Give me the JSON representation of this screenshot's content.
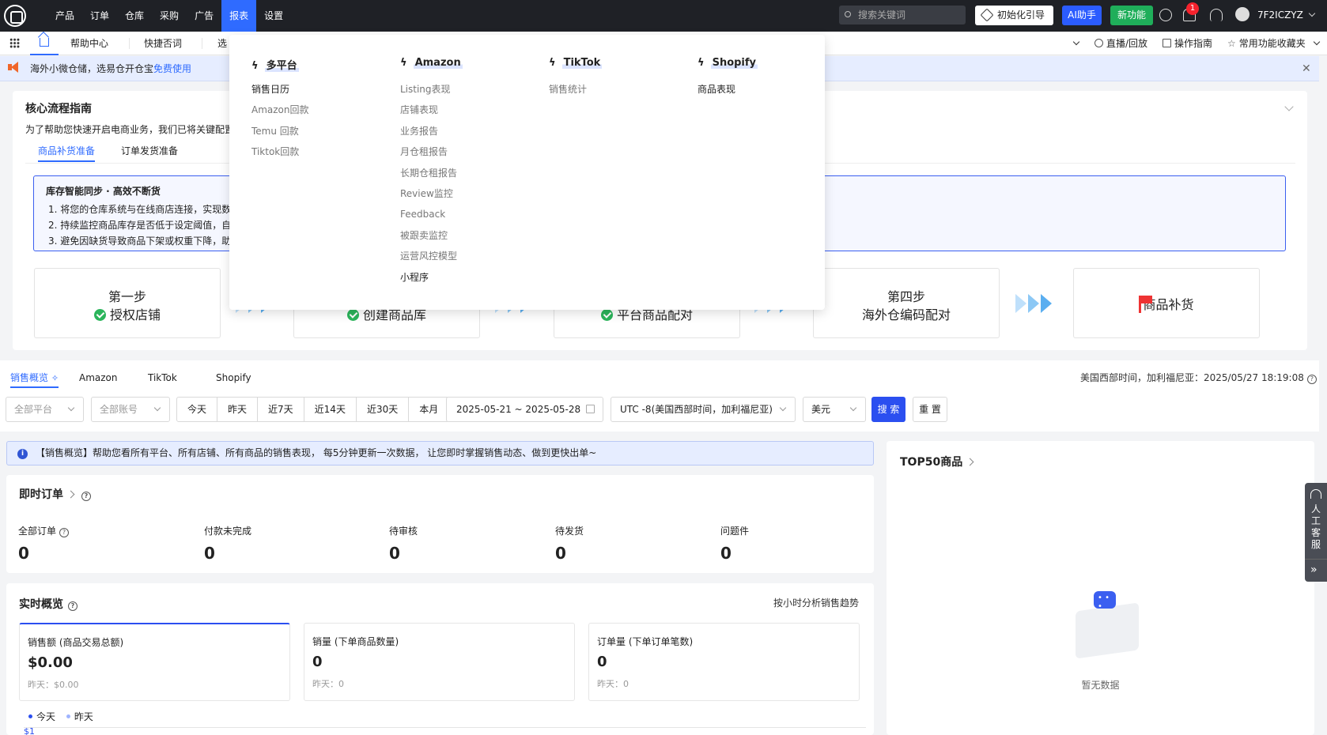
{
  "topbar": {
    "nav": [
      "产品",
      "订单",
      "仓库",
      "采购",
      "广告",
      "报表",
      "设置"
    ],
    "active_nav": "报表",
    "search_placeholder": "搜索关键词",
    "init_guide": "初始化引导",
    "ai_assistant": "AI助手",
    "new_feature": "新功能",
    "notification_count": "1",
    "username": "7F2ICZYZ"
  },
  "tabbar": {
    "tabs": [
      "帮助中心",
      "快捷否词",
      "选"
    ],
    "tools": {
      "live": "直播/回放",
      "guide": "操作指南",
      "favorites": "常用功能收藏夹"
    }
  },
  "notice": {
    "text": "海外小微仓储，选易仓开仓宝",
    "link": "免费使用"
  },
  "guide": {
    "title": "核心流程指南",
    "subtitle": "为了帮助您快速开启电商业务，我们已将关键配置",
    "tabs": [
      "商品补货准备",
      "订单发货准备"
    ],
    "sync_title": "库存智能同步 · 高效不断货",
    "sync_lines": [
      "1. 将您的仓库系统与在线商店连接，实现数",
      "2. 持续监控商品库存是否低于设定阈值，自",
      "3. 避免因缺货导致商品下架或权重下降，助"
    ],
    "steps": [
      {
        "label": "第一步",
        "name": "授权店铺"
      },
      {
        "label": "",
        "name": "创建商品库"
      },
      {
        "label": "",
        "name": "平台商品配对"
      },
      {
        "label": "第四步",
        "name": "海外仓编码配对"
      },
      {
        "label": "",
        "name": "商品补货"
      }
    ]
  },
  "sales": {
    "tabs": [
      "销售概览",
      "Amazon",
      "TikTok",
      "Shopify"
    ],
    "timezone_text": "美国西部时间，加利福尼亚：2025/05/27 18:19:08",
    "filters": {
      "platform": "全部平台",
      "account": "全部账号",
      "ranges": [
        "今天",
        "昨天",
        "近7天",
        "近14天",
        "近30天",
        "本月"
      ],
      "date_range": "2025-05-21 ~ 2025-05-28",
      "timezone": "UTC -8(美国西部时间，加利福尼亚)",
      "currency": "美元",
      "search": "搜 索",
      "reset": "重 置"
    },
    "info": "【销售概览】帮助您看所有平台、所有店铺、所有商品的销售表现， 每5分钟更新一次数据， 让您即时掌握销售动态、做到更快出单~"
  },
  "instant_orders": {
    "title": "即时订单",
    "stats": [
      {
        "label": "全部订单",
        "value": "0"
      },
      {
        "label": "付款未完成",
        "value": "0"
      },
      {
        "label": "待审核",
        "value": "0"
      },
      {
        "label": "待发货",
        "value": "0"
      },
      {
        "label": "问题件",
        "value": "0"
      }
    ]
  },
  "realtime": {
    "title": "实时概览",
    "hourly_link": "按小时分析销售趋势",
    "metrics": [
      {
        "label": "销售额 (商品交易总额)",
        "value": "$0.00",
        "yesterday": "昨天：$0.00"
      },
      {
        "label": "销量 (下单商品数量)",
        "value": "0",
        "yesterday": "昨天：0"
      },
      {
        "label": "订单量 (下单订单笔数)",
        "value": "0",
        "yesterday": "昨天：0"
      }
    ],
    "legend": [
      "今天",
      "昨天"
    ],
    "axis_first": "$1"
  },
  "top50": {
    "title": "TOP50商品",
    "empty": "暂无数据"
  },
  "side_float": {
    "label": "人工客服"
  },
  "dropdown": {
    "columns": [
      {
        "title": "多平台",
        "items": [
          "销售日历",
          "Amazon回款",
          "Temu 回款",
          "Tiktok回款"
        ]
      },
      {
        "title": "Amazon",
        "items": [
          "Listing表现",
          "店铺表现",
          "业务报告",
          "月仓租报告",
          "长期仓租报告",
          "Review监控",
          "Feedback",
          "被跟卖监控",
          "运营风控模型",
          "小程序"
        ]
      },
      {
        "title": "TikTok",
        "items": [
          "销售统计"
        ]
      },
      {
        "title": "Shopify",
        "items": [
          "商品表现"
        ]
      }
    ]
  },
  "colors": {
    "primary": "#2f6bff",
    "topbar": "#1f2126",
    "success": "#2bb55b",
    "new_feature": "#1fae5a"
  }
}
